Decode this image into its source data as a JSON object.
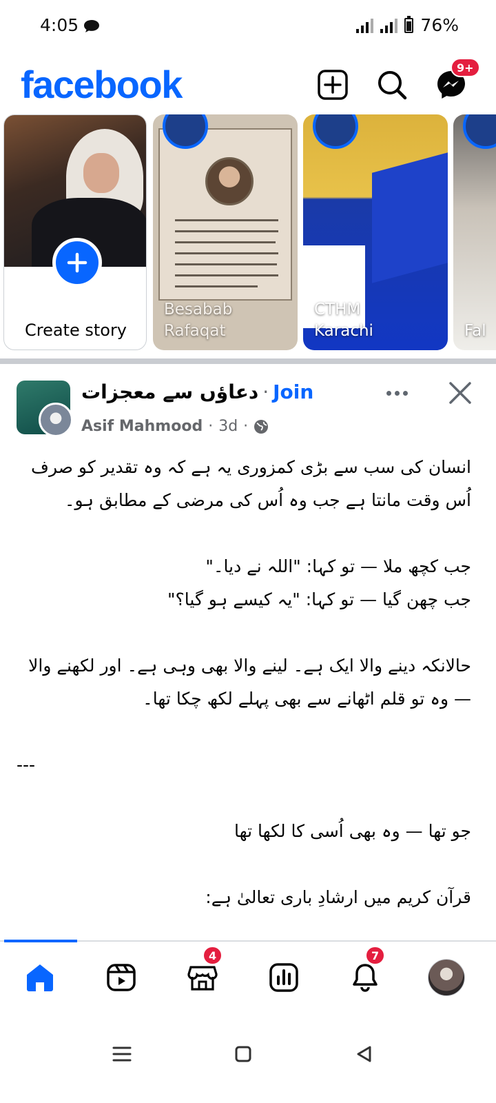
{
  "status_bar": {
    "time": "4:05",
    "battery": "76%"
  },
  "header": {
    "logo": "facebook",
    "messenger_badge": "9+",
    "colors": {
      "brand": "#0866ff",
      "badge": "#e41e3f"
    }
  },
  "stories": [
    {
      "type": "create",
      "label": "Create story"
    },
    {
      "type": "story",
      "name_line1": "Besabab",
      "name_line2": "Rafaqat"
    },
    {
      "type": "story",
      "name_line1": "CTHM",
      "name_line2": "Karachi"
    },
    {
      "type": "story",
      "name_line1": "Fal",
      "name_line2": ""
    }
  ],
  "post": {
    "group_name": "دعاؤں سے معجزات",
    "separator": "·",
    "join_label": "Join",
    "author": "Asif Mahmood",
    "time": "3d",
    "privacy_icon": "globe-icon",
    "lines": [
      "انسان کی سب سے بڑی کمزوری یہ ہے کہ وہ تقدیر کو صرف اُس وقت مانتا ہے جب وہ اُس کی مرضی کے مطابق ہو۔",
      "",
      "جب کچھ ملا — تو کہا: \"اللہ نے دیا۔\"",
      "جب چھن گیا — تو کہا: \"یہ کیسے ہو گیا؟\"",
      "",
      "حالانکہ دینے والا ایک ہے۔ لینے والا بھی وہی ہے۔ اور لکھنے والا — وہ تو قلم اٹھانے سے بھی پہلے لکھ چکا تھا۔",
      "",
      "---",
      "",
      "جو تھا — وہ بھی اُسی کا لکھا تھا",
      "",
      "قرآن کریم میں ارشادِ باری تعالیٰ ہے:"
    ]
  },
  "bottom_nav": {
    "items": [
      {
        "name": "home-icon",
        "active": true
      },
      {
        "name": "video-icon"
      },
      {
        "name": "marketplace-icon",
        "badge": "4"
      },
      {
        "name": "dashboard-icon"
      },
      {
        "name": "notifications-icon",
        "badge": "7"
      },
      {
        "name": "profile-avatar"
      }
    ]
  },
  "android_nav": [
    "menu-icon",
    "home-square-icon",
    "back-triangle-icon"
  ]
}
